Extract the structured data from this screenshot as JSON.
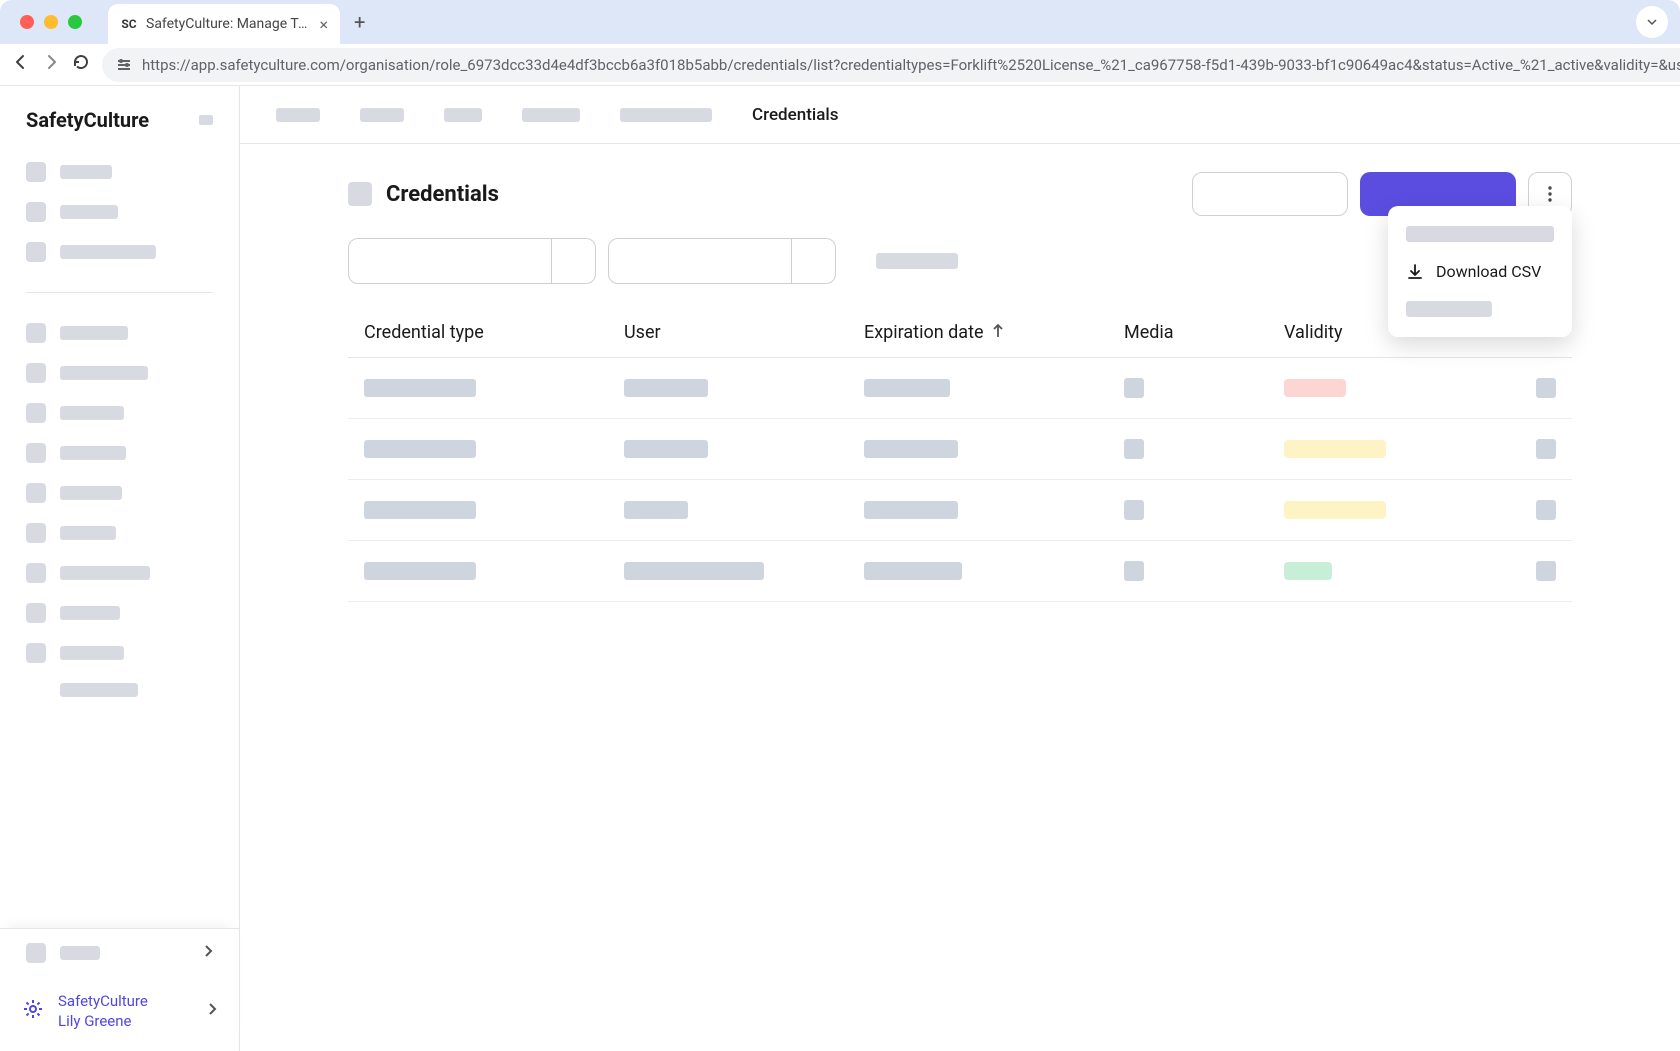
{
  "browser": {
    "tab_title": "SafetyCulture: Manage Teams and...",
    "url": "https://app.safetyculture.com/organisation/role_6973dcc33d4e4df3bccb6a3f018b5abb/credentials/list?credentialtypes=Forklift%2520License_%21_ca967758-f5d1-439b-9033-bf1c90649ac4&status=Active_%21_active&validity=&users="
  },
  "sidebar": {
    "brand": "SafetyCulture",
    "org_name": "SafetyCulture",
    "user_name": "Lily Greene"
  },
  "top_tabs": {
    "active": "Credentials"
  },
  "page": {
    "title": "Credentials"
  },
  "table": {
    "headers": {
      "type": "Credential type",
      "user": "User",
      "expiration": "Expiration date",
      "media": "Media",
      "validity": "Validity"
    },
    "rows": [
      {
        "validity_class": "pill-red"
      },
      {
        "validity_class": "pill-yellow"
      },
      {
        "validity_class": "pill-yellow"
      },
      {
        "validity_class": "pill-green"
      }
    ]
  },
  "menu": {
    "download_csv": "Download CSV"
  }
}
